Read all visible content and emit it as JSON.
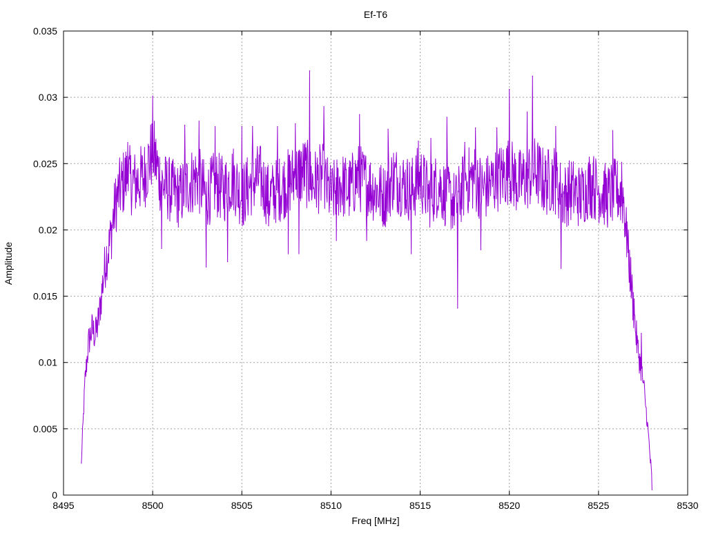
{
  "chart_data": {
    "type": "line",
    "title": "Ef-T6",
    "xlabel": "Freq [MHz]",
    "ylabel": "Amplitude",
    "xlim": [
      8495,
      8530
    ],
    "ylim": [
      0,
      0.035
    ],
    "xticks": [
      "8495",
      "8500",
      "8505",
      "8510",
      "8515",
      "8520",
      "8525",
      "8530"
    ],
    "yticks": [
      "0",
      "0.005",
      "0.01",
      "0.015",
      "0.02",
      "0.025",
      "0.03",
      "0.035"
    ],
    "grid": true,
    "legend": "none",
    "series": [
      {
        "color": "#9400d3",
        "x": [
          8496.0,
          8496.2,
          8496.4,
          8496.6,
          8496.8,
          8497.0,
          8497.2,
          8497.4,
          8497.6,
          8497.8,
          8498.0,
          8498.5,
          8499.0,
          8499.5,
          8500.0,
          8500.5,
          8501.0,
          8501.5,
          8502.0,
          8502.5,
          8503.0,
          8503.5,
          8504.0,
          8504.5,
          8505.0,
          8505.5,
          8506.0,
          8506.5,
          8507.0,
          8507.5,
          8508.0,
          8508.5,
          8509.0,
          8509.5,
          8510.0,
          8510.5,
          8511.0,
          8511.5,
          8512.0,
          8512.5,
          8513.0,
          8513.5,
          8514.0,
          8514.5,
          8515.0,
          8515.5,
          8516.0,
          8516.5,
          8517.0,
          8517.5,
          8518.0,
          8518.5,
          8519.0,
          8519.5,
          8520.0,
          8520.5,
          8521.0,
          8521.5,
          8522.0,
          8522.5,
          8523.0,
          8523.5,
          8524.0,
          8524.5,
          8525.0,
          8525.5,
          8526.0,
          8526.4,
          8526.6,
          8526.8,
          8527.0,
          8527.2,
          8527.4,
          8527.6,
          8527.8,
          8528.0
        ],
        "y": [
          0.0025,
          0.0085,
          0.0115,
          0.0125,
          0.012,
          0.0135,
          0.016,
          0.018,
          0.019,
          0.021,
          0.0225,
          0.024,
          0.0235,
          0.024,
          0.026,
          0.0235,
          0.023,
          0.0225,
          0.0235,
          0.024,
          0.0225,
          0.0235,
          0.023,
          0.024,
          0.0225,
          0.0235,
          0.024,
          0.0225,
          0.023,
          0.0235,
          0.024,
          0.0245,
          0.0235,
          0.024,
          0.0225,
          0.0235,
          0.023,
          0.024,
          0.0235,
          0.023,
          0.0225,
          0.024,
          0.0235,
          0.023,
          0.024,
          0.0225,
          0.0235,
          0.0225,
          0.022,
          0.0235,
          0.024,
          0.023,
          0.0235,
          0.024,
          0.0245,
          0.0235,
          0.024,
          0.0245,
          0.0235,
          0.024,
          0.0225,
          0.023,
          0.0225,
          0.0235,
          0.023,
          0.0225,
          0.023,
          0.0225,
          0.019,
          0.0165,
          0.0135,
          0.011,
          0.0095,
          0.0075,
          0.0045,
          0.001
        ],
        "spikes": [
          [
            8496.0,
            0.0024
          ],
          [
            8496.8,
            0.0133
          ],
          [
            8497.6,
            0.0198
          ],
          [
            8498.6,
            0.0266
          ],
          [
            8500.0,
            0.0301
          ],
          [
            8500.5,
            0.0186
          ],
          [
            8501.8,
            0.0279
          ],
          [
            8502.6,
            0.0282
          ],
          [
            8503.0,
            0.0172
          ],
          [
            8503.5,
            0.0278
          ],
          [
            8504.2,
            0.0176
          ],
          [
            8505.0,
            0.0278
          ],
          [
            8505.1,
            0.0204
          ],
          [
            8505.6,
            0.0278
          ],
          [
            8506.5,
            0.0203
          ],
          [
            8507.0,
            0.0278
          ],
          [
            8507.6,
            0.0182
          ],
          [
            8508.0,
            0.028
          ],
          [
            8508.2,
            0.0182
          ],
          [
            8508.8,
            0.032
          ],
          [
            8509.6,
            0.0293
          ],
          [
            8510.0,
            0.0223
          ],
          [
            8510.3,
            0.0192
          ],
          [
            8511.6,
            0.0287
          ],
          [
            8512.0,
            0.0192
          ],
          [
            8513.2,
            0.0276
          ],
          [
            8514.5,
            0.0182
          ],
          [
            8514.9,
            0.0267
          ],
          [
            8515.6,
            0.0269
          ],
          [
            8516.5,
            0.0285
          ],
          [
            8517.1,
            0.0141
          ],
          [
            8517.5,
            0.0266
          ],
          [
            8518.1,
            0.0277
          ],
          [
            8518.4,
            0.0185
          ],
          [
            8519.3,
            0.0277
          ],
          [
            8520.0,
            0.0306
          ],
          [
            8521.0,
            0.0289
          ],
          [
            8521.3,
            0.0316
          ],
          [
            8522.6,
            0.0278
          ],
          [
            8522.9,
            0.0171
          ],
          [
            8524.3,
            0.0213
          ],
          [
            8524.7,
            0.0249
          ],
          [
            8525.8,
            0.0275
          ],
          [
            8526.3,
            0.0251
          ],
          [
            8526.6,
            0.0206
          ],
          [
            8527.0,
            0.0148
          ],
          [
            8527.4,
            0.0122
          ],
          [
            8527.6,
            0.0076
          ],
          [
            8528.0,
            0.0004
          ]
        ]
      }
    ]
  }
}
